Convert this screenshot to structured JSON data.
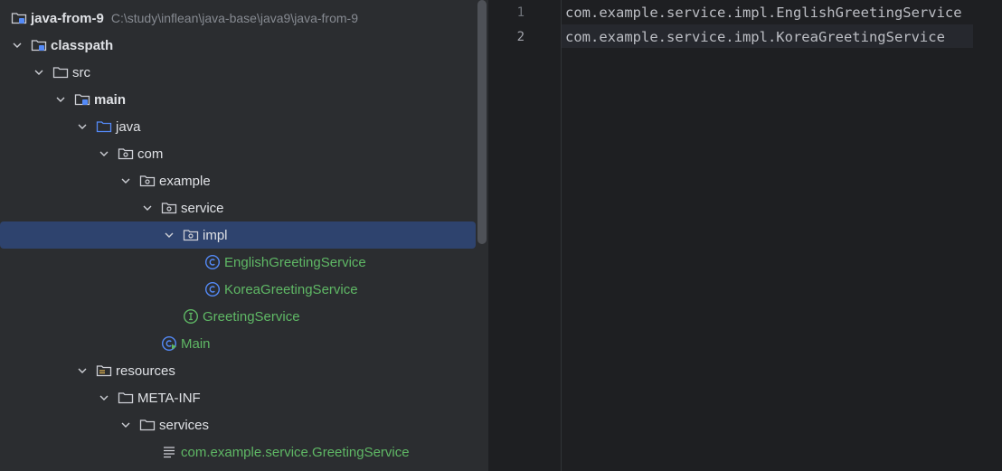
{
  "project": {
    "name": "java-from-9",
    "path": "C:\\study\\inflean\\java-base\\java9\\java-from-9"
  },
  "tree": [
    {
      "label": "classpath",
      "icon": "module-folder-icon",
      "bold": true
    },
    {
      "label": "src",
      "icon": "folder-icon"
    },
    {
      "label": "main",
      "icon": "module-folder-icon",
      "bold": true
    },
    {
      "label": "java",
      "icon": "source-root-folder-icon"
    },
    {
      "label": "com",
      "icon": "package-icon"
    },
    {
      "label": "example",
      "icon": "package-icon"
    },
    {
      "label": "service",
      "icon": "package-icon"
    },
    {
      "label": "impl",
      "icon": "package-icon"
    },
    {
      "label": "EnglishGreetingService",
      "icon": "class-icon"
    },
    {
      "label": "KoreaGreetingService",
      "icon": "class-icon"
    },
    {
      "label": "GreetingService",
      "icon": "interface-icon"
    },
    {
      "label": "Main",
      "icon": "runnable-class-icon"
    },
    {
      "label": "resources",
      "icon": "resources-folder-icon"
    },
    {
      "label": "META-INF",
      "icon": "folder-icon"
    },
    {
      "label": "services",
      "icon": "folder-icon"
    },
    {
      "label": "com.example.service.GreetingService",
      "icon": "text-file-icon"
    }
  ],
  "editor": {
    "lines": [
      {
        "number": "1",
        "text": "com.example.service.impl.EnglishGreetingService"
      },
      {
        "number": "2",
        "text": "com.example.service.impl.KoreaGreetingService"
      }
    ]
  },
  "colors": {
    "tree_bg": "#2b2d30",
    "editor_bg": "#1e1f22",
    "selection": "#2e436e",
    "class_green": "#5fb865",
    "icon_blue": "#548af7"
  }
}
